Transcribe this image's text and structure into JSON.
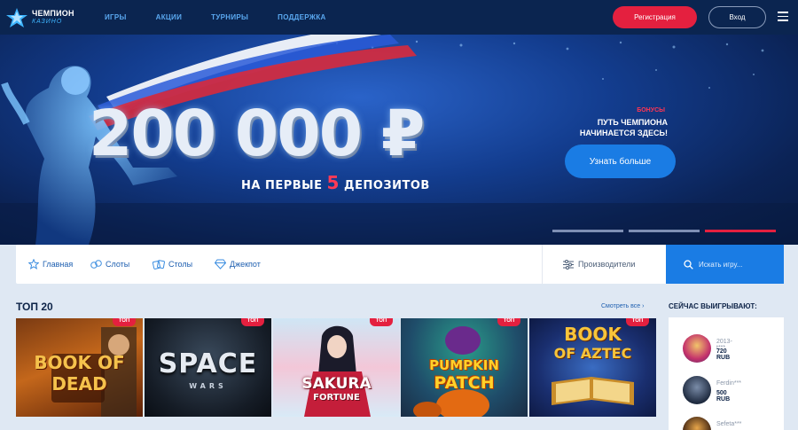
{
  "header": {
    "logo_title": "ЧЕМПИОН",
    "logo_sub": "КАЗИНО",
    "nav": [
      "ИГРЫ",
      "АКЦИИ",
      "ТУРНИРЫ",
      "ПОДДЕРЖКА"
    ],
    "register_label": "Регистрация",
    "login_label": "Вход",
    "colors": {
      "bg": "#0b2550",
      "accent": "#e4203f",
      "link": "#5aa8f0"
    }
  },
  "banner": {
    "amount": "200 000 ₽",
    "deposit_prefix": "НА ПЕРВЫЕ",
    "deposit_num": "5",
    "deposit_suffix": "ДЕПОЗИТОВ",
    "bonus_label": "БОНУСЫ",
    "bonus_title_line1": "ПУТЬ ЧЕМПИОНА",
    "bonus_title_line2": "НАЧИНАЕТСЯ ЗДЕСЬ!",
    "cta_label": "Узнать больше",
    "slides": 3,
    "active_slide": 3
  },
  "categories": {
    "items": [
      {
        "label": "Главная",
        "icon": "star-icon"
      },
      {
        "label": "Слоты",
        "icon": "slots-icon"
      },
      {
        "label": "Столы",
        "icon": "cards-icon"
      },
      {
        "label": "Джекпот",
        "icon": "diamond-icon"
      }
    ],
    "providers_label": "Производители",
    "search_placeholder": "Искать игру..."
  },
  "top": {
    "title": "ТОП 20",
    "see_all": "Смотреть все",
    "games": [
      {
        "title": "BOOK OF DEAD",
        "tag": "ТОП"
      },
      {
        "title": "SPACE",
        "subtitle": "WARS",
        "tag": "ТОП"
      },
      {
        "title": "SAKURA",
        "subtitle": "FORTUNE",
        "tag": "ТОП"
      },
      {
        "title": "PUMPKIN",
        "subtitle": "PATCH",
        "tag": "ТОП"
      },
      {
        "title": "BOOK",
        "subtitle": "OF AZTEC",
        "tag": "ТОП"
      }
    ]
  },
  "winners": {
    "title": "СЕЙЧАС ВЫИГРЫВАЮТ:",
    "list": [
      {
        "name": "2013-t***",
        "amount": "720 RUB"
      },
      {
        "name": "Ferdin***",
        "amount": "500 RUB"
      },
      {
        "name": "Sefeta***",
        "amount": ""
      }
    ]
  }
}
